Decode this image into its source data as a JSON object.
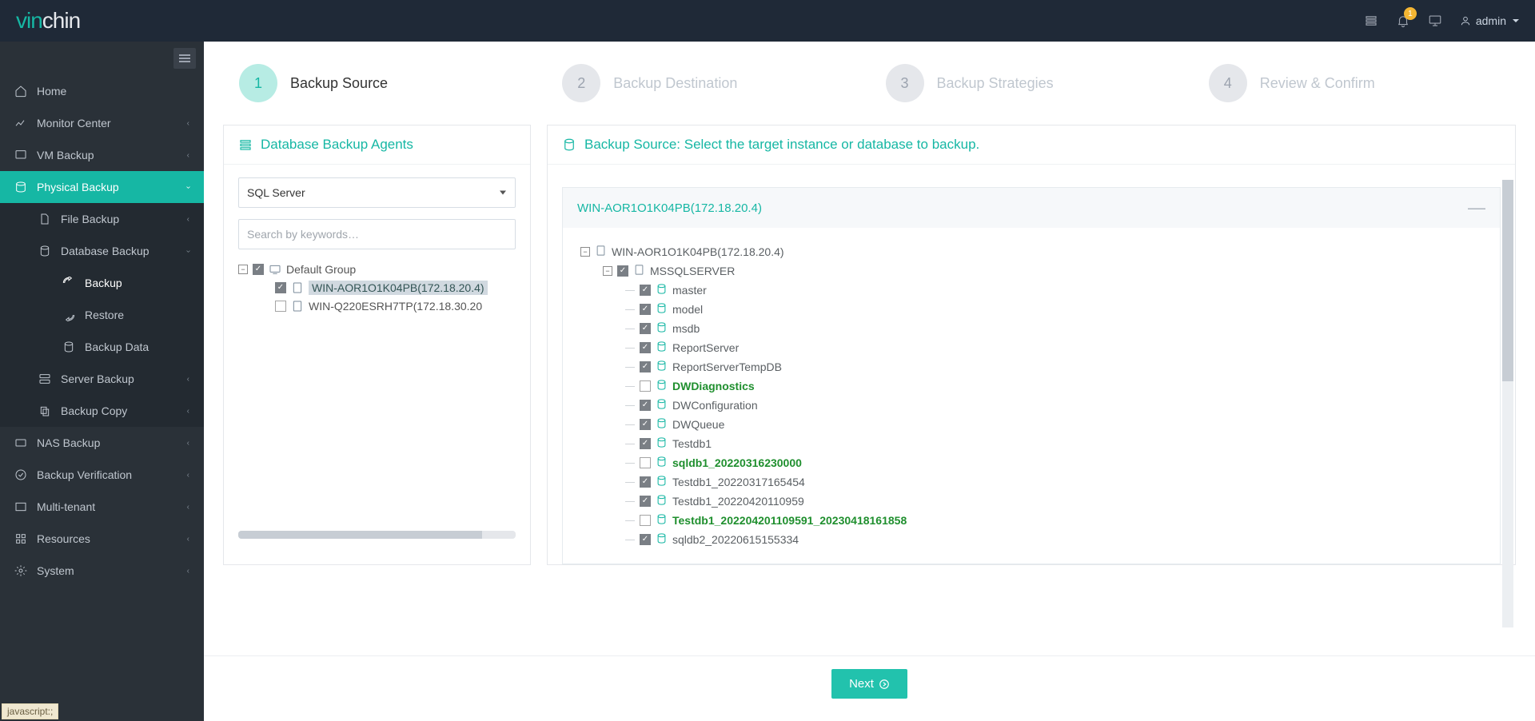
{
  "brand": {
    "part1": "vin",
    "part2": "chin"
  },
  "header": {
    "badge": "1",
    "user": "admin"
  },
  "sidebar": {
    "home": "Home",
    "monitor": "Monitor Center",
    "vm": "VM Backup",
    "physical": "Physical Backup",
    "file": "File Backup",
    "dbbackup": "Database Backup",
    "backup": "Backup",
    "restore": "Restore",
    "backupdata": "Backup Data",
    "serverbackup": "Server Backup",
    "backupcopy": "Backup Copy",
    "nas": "NAS Backup",
    "verif": "Backup Verification",
    "multi": "Multi-tenant",
    "resources": "Resources",
    "system": "System"
  },
  "wizard": {
    "s1": "Backup Source",
    "s2": "Backup Destination",
    "s3": "Backup Strategies",
    "s4": "Review & Confirm"
  },
  "leftPanel": {
    "title": "Database Backup Agents",
    "dbtype": "SQL Server",
    "search_ph": "Search by keywords…",
    "group": "Default Group",
    "host1": "WIN-AOR1O1K04PB(172.18.20.4)",
    "host2": "WIN-Q220ESRH7TP(172.18.30.20"
  },
  "rightPanel": {
    "title": "Backup Source: Select the target instance or database to backup.",
    "target_host": "WIN-AOR1O1K04PB(172.18.20.4)",
    "root": "WIN-AOR1O1K04PB(172.18.20.4)",
    "instance": "MSSQLSERVER",
    "dbs": {
      "master": "master",
      "model": "model",
      "msdb": "msdb",
      "reportserver": "ReportServer",
      "rst": "ReportServerTempDB",
      "dwdiag": "DWDiagnostics",
      "dwconf": "DWConfiguration",
      "dwqueue": "DWQueue",
      "testdb1": "Testdb1",
      "sqldb1": "sqldb1_20220316230000",
      "testdb1a": "Testdb1_20220317165454",
      "testdb1b": "Testdb1_20220420110959",
      "testdb1c": "Testdb1_202204201109591_20230418161858",
      "sqldb2": "sqldb2_20220615155334"
    }
  },
  "footer": {
    "next": "Next"
  },
  "status": "javascript:;"
}
